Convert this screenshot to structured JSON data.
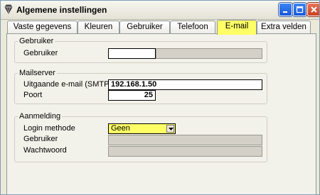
{
  "window": {
    "title": "Algemene instellingen"
  },
  "tabs": [
    {
      "label": "Vaste gegevens",
      "active": false
    },
    {
      "label": "Kleuren",
      "active": false
    },
    {
      "label": "Gebruiker",
      "active": false
    },
    {
      "label": "Telefoon",
      "active": false
    },
    {
      "label": "E-mail",
      "active": true
    },
    {
      "label": "Extra velden",
      "active": false
    }
  ],
  "groups": {
    "gebruiker": {
      "title": "Gebruiker",
      "label": "Gebruiker",
      "value": ""
    },
    "mailserver": {
      "title": "Mailserver",
      "smtp_label": "Uitgaande e-mail (SMTP)",
      "smtp_value": "192.168.1.50",
      "port_label": "Poort",
      "port_value": "25"
    },
    "aanmelding": {
      "title": "Aanmelding",
      "method_label": "Login methode",
      "method_value": "Geen",
      "user_label": "Gebruiker",
      "user_value": "",
      "password_label": "Wachtwoord",
      "password_value": ""
    }
  },
  "colors": {
    "active_tab": "#ffff66",
    "combo_background": "#ffff66",
    "disabled_field": "#d4d0c8"
  }
}
